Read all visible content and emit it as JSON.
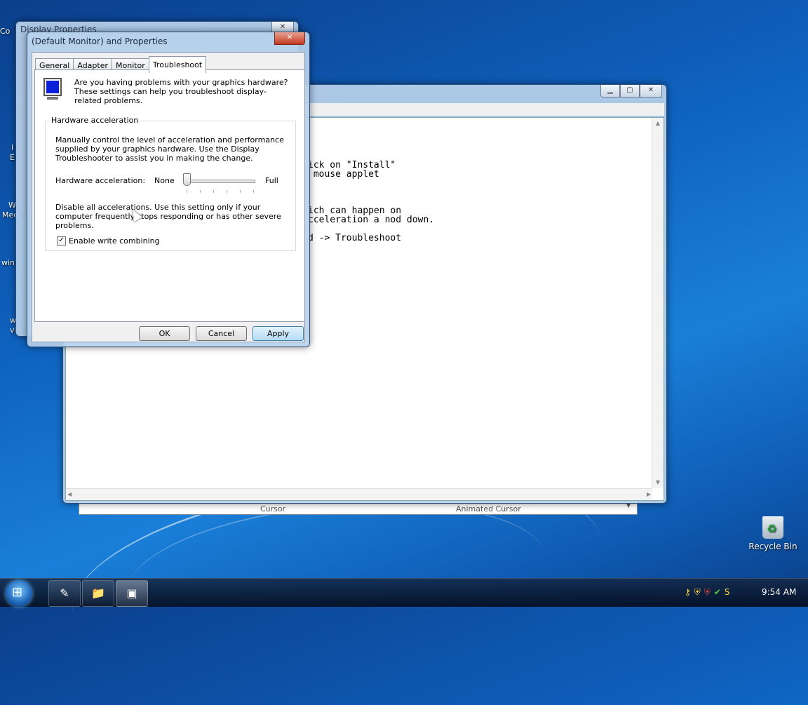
{
  "desktop": {
    "recycle_bin_label": "Recycle Bin",
    "left_partial_labels": [
      "Co",
      "I",
      "E",
      "W",
      "Med",
      "win",
      "w",
      "vi"
    ]
  },
  "display_properties_window": {
    "title": "Display Properties",
    "close_glyph": "✕"
  },
  "notepad_window": {
    "caption_buttons": {
      "minimize": "▁",
      "maximize": "▢",
      "close": "✕"
    },
    "text_lines": [
      "",
      "ick on \"Install\"",
      " mouse applet",
      "",
      "",
      "",
      "ich can happen on",
      "cceleration a nod down.",
      "",
      "d -> Troubleshoot"
    ],
    "scroll_up": "▲",
    "scroll_down": "▼",
    "scroll_left": "◀",
    "scroll_right": "▶"
  },
  "mouse_strip": {
    "items": [
      "Cursor",
      "Animated Cursor"
    ],
    "dropdown_glyph": "▼"
  },
  "dialog": {
    "title": "(Default Monitor) and  Properties",
    "close_glyph": "✕",
    "tabs": [
      "General",
      "Adapter",
      "Monitor",
      "Troubleshoot"
    ],
    "active_tab": "Troubleshoot",
    "intro": "Are you having problems with your graphics hardware? These settings can help you troubleshoot display-related problems.",
    "group_title": "Hardware acceleration",
    "description": "Manually control the level of acceleration and performance supplied by your graphics hardware. Use the Display Troubleshooter to assist you in making the change.",
    "hw_label": "Hardware acceleration:",
    "slider_min": "None",
    "slider_max": "Full",
    "slider_value": 0,
    "warning": "Disable all accelerations. Use this setting only if your computer frequently stops responding or has other severe problems.",
    "checkbox_label": "Enable write combining",
    "checkbox_checked": true,
    "checkbox_mark": "✓",
    "buttons": {
      "ok": "OK",
      "cancel": "Cancel",
      "apply": "Apply"
    }
  },
  "taskbar": {
    "start_glyph": "⊞",
    "buttons": [
      "✎",
      "📁",
      "▣"
    ],
    "tray_icons": [
      "⚷",
      "⛨",
      "⛨",
      "✔",
      "S"
    ],
    "clock": "9:54 AM"
  }
}
